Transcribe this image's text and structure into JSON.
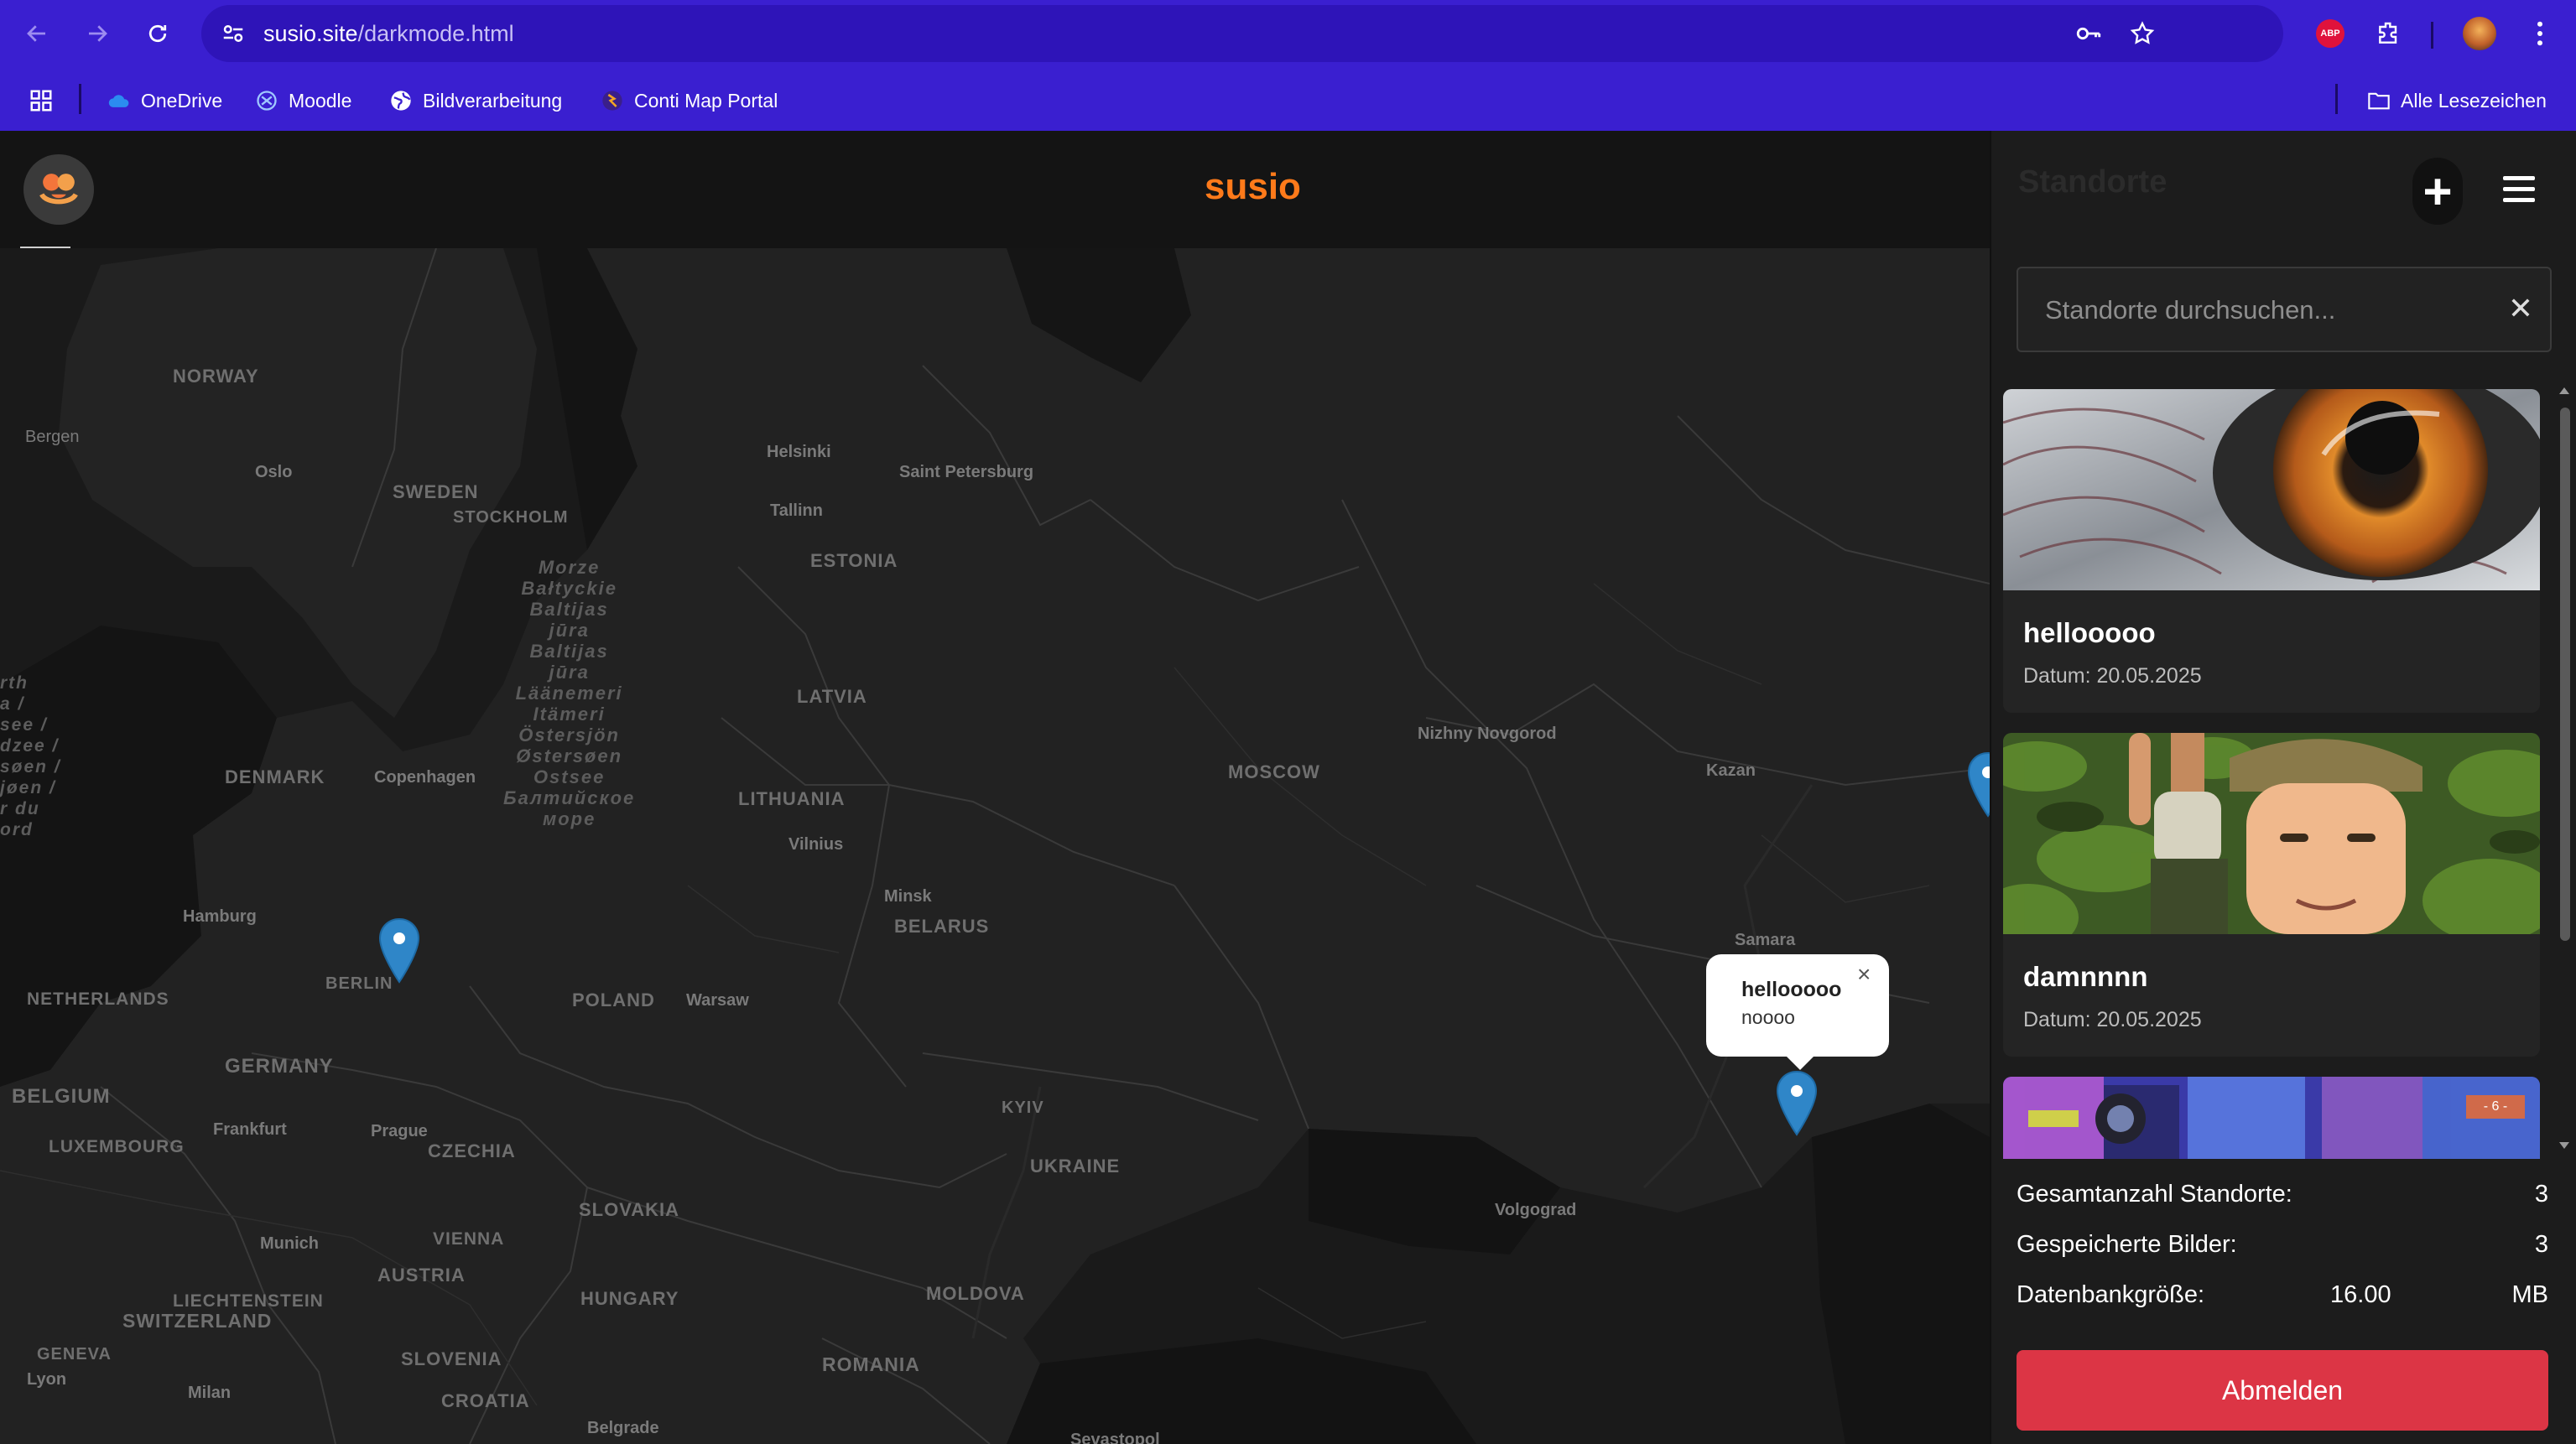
{
  "browser": {
    "url_host": "susio.site",
    "url_path": "/darkmode.html",
    "abp_label": "ABP",
    "bookmarks": [
      {
        "label": "OneDrive",
        "icon": "onedrive-icon"
      },
      {
        "label": "Moodle",
        "icon": "moodle-icon"
      },
      {
        "label": "Bildverarbeitung",
        "icon": "globe-icon"
      },
      {
        "label": "Conti Map Portal",
        "icon": "conti-icon"
      }
    ],
    "all_bookmarks": "Alle Lesezeichen"
  },
  "header": {
    "brand": "susio"
  },
  "sidebar": {
    "title": "Standorte",
    "search_placeholder": "Standorte durchsuchen...",
    "cards": [
      {
        "title": "hellooooo",
        "date": "Datum: 20.05.2025"
      },
      {
        "title": "damnnnn",
        "date": "Datum: 20.05.2025"
      },
      {
        "title": "",
        "date": "",
        "badge": "- 6 -"
      }
    ],
    "stats": [
      {
        "label": "Gesamtanzahl Standorte:",
        "value": "3"
      },
      {
        "label": "Gespeicherte Bilder:",
        "value": "3"
      },
      {
        "label": "Datenbankgröße:",
        "value": "16.00",
        "unit": "MB"
      }
    ],
    "logout": "Abmelden"
  },
  "map": {
    "popup": {
      "title": "hellooooo",
      "text": "noooo",
      "close": "×"
    },
    "labels": {
      "norway": "NORWAY",
      "bergen": "Bergen",
      "oslo": "Oslo",
      "sweden": "SWEDEN",
      "stockholm": "STOCKHOLM",
      "helsinki": "Helsinki",
      "saint_petersburg": "Saint Petersburg",
      "tallinn": "Tallinn",
      "estonia": "ESTONIA",
      "latvia": "LATVIA",
      "denmark": "DENMARK",
      "copenhagen": "Copenhagen",
      "moscow": "MOSCOW",
      "nizhny": "Nizhny Novgorod",
      "kazan": "Kazan",
      "lithuania": "LITHUANIA",
      "vilnius": "Vilnius",
      "minsk": "Minsk",
      "belarus": "BELARUS",
      "hamburg": "Hamburg",
      "berlin": "BERLIN",
      "samara": "Samara",
      "netherlands": "NETHERLANDS",
      "poland": "POLAND",
      "warsaw": "Warsaw",
      "germany": "GERMANY",
      "belgium": "BELGIUM",
      "frankfurt": "Frankfurt",
      "prague": "Prague",
      "kyiv": "KYIV",
      "luxembourg": "LUXEMBOURG",
      "czechia": "CZECHIA",
      "ukraine": "UKRAINE",
      "slovakia": "SLOVAKIA",
      "volgograd": "Volgograd",
      "vienna": "VIENNA",
      "munich": "Munich",
      "austria": "AUSTRIA",
      "liechtenstein": "LIECHTENSTEIN",
      "moldova": "MOLDOVA",
      "hungary": "HUNGARY",
      "switzerland": "SWITZERLAND",
      "geneva": "GENEVA",
      "lyon": "Lyon",
      "slovenia": "SLOVENIA",
      "romania": "ROMANIA",
      "milan": "Milan",
      "croatia": "CROATIA",
      "belgrade": "Belgrade",
      "sevastopol": "Sevastopol",
      "baltic_sea": "Morze\nBałtyckie\nBaltijas\njūra\nBaltijas\njūra\nLäänemeri\nItämeri\nÖstersjön\nØstersøen\nOstsee\nБалтийское\nморе",
      "north_sea_edge": "rth\na /\nsee /\ndzee /\nsøen /\njøen /\nr du\nord"
    }
  },
  "colors": {
    "browser_bar": "#3a1fd0",
    "brand_orange": "#ff7a1a",
    "logout_red": "#dc3545",
    "pin_blue": "#2f86c8"
  }
}
